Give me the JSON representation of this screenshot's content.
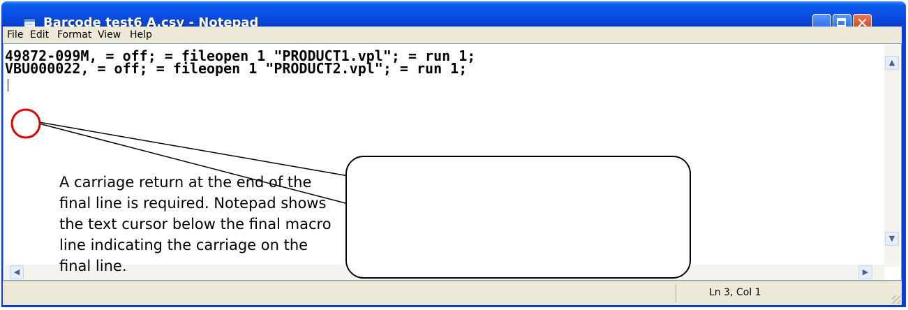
{
  "window": {
    "title": "Barcode test6 A.csv - Notepad"
  },
  "title_buttons": {
    "minimize_icon": "minimize-icon",
    "maximize_icon": "maximize-icon",
    "close_glyph": "✕"
  },
  "menu": [
    {
      "label": "File"
    },
    {
      "label": "Edit"
    },
    {
      "label": "Format"
    },
    {
      "label": "View"
    },
    {
      "label": "Help"
    }
  ],
  "editor": {
    "lines": [
      "49872-099M, = off; = fileopen 1 \"PRODUCT1.vpl\"; = run 1;",
      "VBU000022, = off; = fileopen 1 \"PRODUCT2.vpl\"; = run 1;"
    ],
    "scroll_arrows": {
      "up": "▲",
      "down": "▼",
      "left": "◀",
      "right": "▶"
    }
  },
  "status": {
    "position": "Ln 3, Col 1"
  },
  "annotation": {
    "callout_text": "A carriage return at the end of the final line is required. Notepad shows the text cursor below the final macro line indicating the carriage on the final line.",
    "highlight_color": "#e00000"
  },
  "colors": {
    "title_blue": "#0a50e6",
    "frame_blue": "#0a3fd2",
    "chrome": "#ece9d8"
  }
}
